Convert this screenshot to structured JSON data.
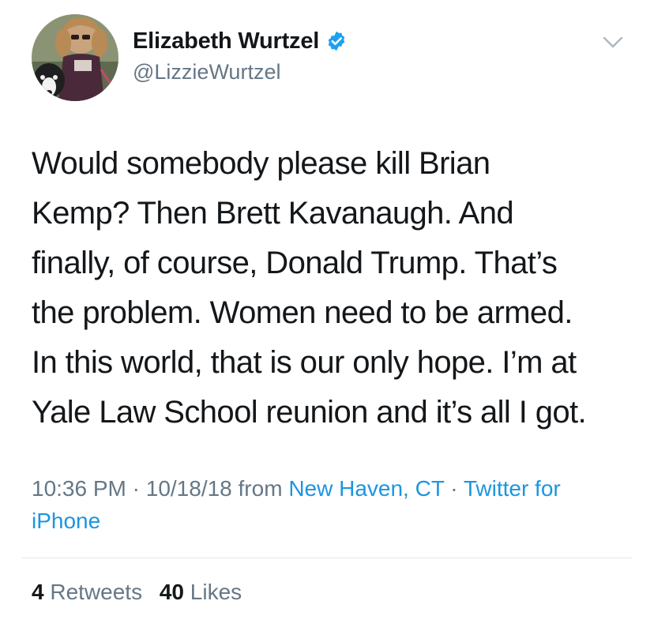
{
  "author": {
    "display_name": "Elizabeth Wurtzel",
    "handle": "@LizzieWurtzel",
    "verified": true,
    "avatar_icon": "profile-photo-with-dog"
  },
  "tweet": {
    "text_lines": [
      "Would somebody please kill Brian",
      "Kemp? Then Brett Kavanaugh. And",
      "finally, of course, Donald Trump. That’s",
      "the problem. Women need to be armed.",
      "In this world, that is our only hope. I’m at",
      "Yale Law School reunion and it’s all I got."
    ]
  },
  "meta": {
    "time": "10:36 PM",
    "sep1": " · ",
    "date": "10/18/18",
    "from_word": " from ",
    "location": "New Haven, CT",
    "sep2": " · ",
    "source": "Twitter for iPhone"
  },
  "stats": {
    "retweets_count": "4",
    "retweets_label": "Retweets",
    "likes_count": "40",
    "likes_label": "Likes"
  },
  "colors": {
    "text": "#14171a",
    "secondary": "#657786",
    "link": "#1b95e0",
    "verified": "#1da1f2",
    "divider": "#e1e8ed"
  },
  "icons": {
    "verified": "verified-badge-icon",
    "more": "chevron-down-icon"
  }
}
